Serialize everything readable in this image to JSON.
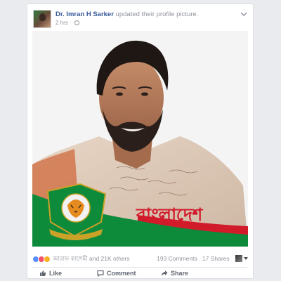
{
  "post": {
    "author_name": "Dr. Imran H Sarker",
    "action_text": " updated their profile picture.",
    "time": "2 hrs",
    "separator": " · "
  },
  "photo": {
    "overlay_text": "বাংলাদেশ",
    "badge_text": "Bangladesh Cricket Board"
  },
  "reactions": {
    "icons": [
      "like-icon",
      "love-icon",
      "wow-icon"
    ],
    "names": "আরাফ কাশেমী and 21K others"
  },
  "stats": {
    "comments": "193 Comments",
    "shares": "17 Shares"
  },
  "actions": {
    "like": "Like",
    "comment": "Comment",
    "share": "Share"
  },
  "colors": {
    "link": "#365899",
    "green": "#0e8a3b",
    "red": "#d11a2a"
  }
}
